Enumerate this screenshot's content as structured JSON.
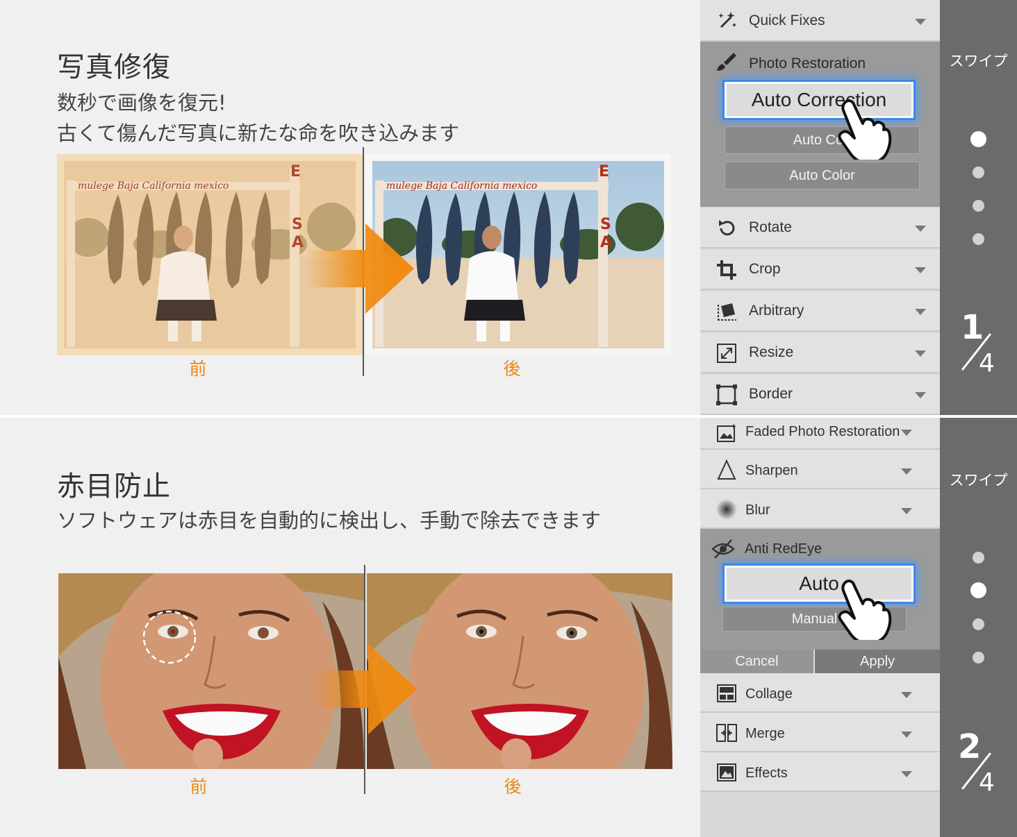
{
  "sections": [
    {
      "heading": "写真修復",
      "desc_lines": [
        "数秒で画像を復元!",
        "古くて傷んだ写真に新たな命を吹き込みます"
      ],
      "before_label": "前",
      "after_label": "後",
      "sign_text": "mulege Baja California mexico"
    },
    {
      "heading": "赤目防止",
      "desc_lines": [
        "ソフトウェアは赤目を自動的に検出し、手動で除去できます"
      ],
      "before_label": "前",
      "after_label": "後"
    }
  ],
  "panel1_tools": {
    "quick_fixes": "Quick Fixes",
    "group_title": "Photo Restoration",
    "primary_button": "Auto Correction",
    "sub_buttons": [
      "Auto Con",
      "Auto Color"
    ],
    "items": [
      "Rotate",
      "Crop",
      "Arbitrary",
      "Resize",
      "Border"
    ]
  },
  "panel2_tools": {
    "items_top": [
      "Faded Photo Restoration",
      "Sharpen",
      "Blur"
    ],
    "group_title": "Anti RedEye",
    "primary_button": "Auto",
    "sub_button": "Manual",
    "cancel": "Cancel",
    "apply": "Apply",
    "items_bottom": [
      "Collage",
      "Merge",
      "Effects"
    ]
  },
  "side": {
    "swipe": "スワイプ",
    "page1": {
      "current": "1",
      "total": "4"
    },
    "page2": {
      "current": "2",
      "total": "4"
    }
  },
  "colors": {
    "accent_orange": "#f08a10",
    "highlight_blue": "#3a88e8",
    "side_gray": "#6b6b6b"
  }
}
